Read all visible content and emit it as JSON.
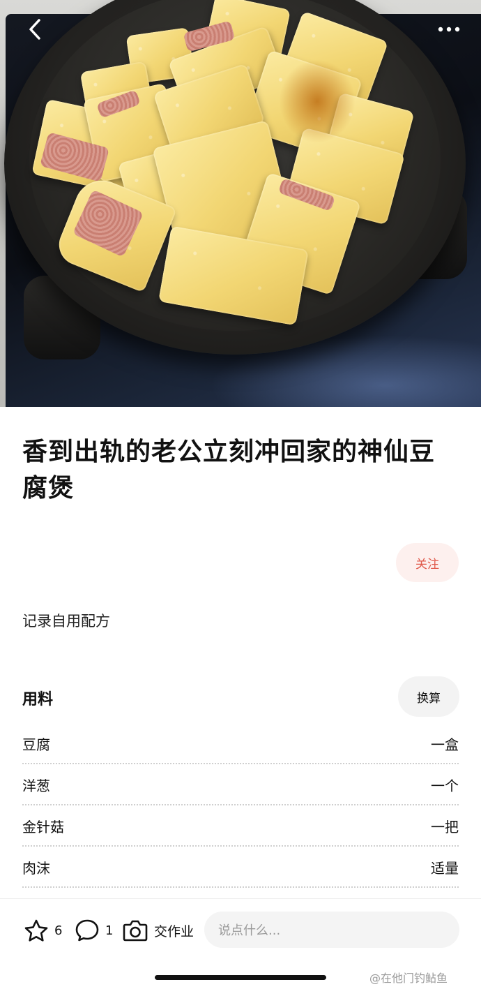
{
  "header": {
    "back_icon": "chevron-left-icon",
    "more_icon": "more-dots-icon"
  },
  "recipe": {
    "title": "香到出轨的老公立刻冲回家的神仙豆腐煲",
    "follow_label": "关注",
    "description": "记录自用配方"
  },
  "ingredients_section": {
    "heading": "用料",
    "convert_label": "换算",
    "items": [
      {
        "name": "豆腐",
        "amount": "一盒"
      },
      {
        "name": "洋葱",
        "amount": "一个"
      },
      {
        "name": "金针菇",
        "amount": "一把"
      },
      {
        "name": "肉沫",
        "amount": "适量"
      }
    ]
  },
  "bottom_bar": {
    "star_icon": "star-icon",
    "star_count": "6",
    "comment_icon": "comment-bubble-icon",
    "comment_count": "1",
    "camera_icon": "camera-icon",
    "homework_label": "交作业",
    "input_placeholder": "说点什么..."
  },
  "watermark": "@在他门钓鲇鱼",
  "colors": {
    "accent_red": "#e0594a",
    "follow_bg": "#fdf0ee",
    "pill_bg": "#f3f3f3"
  }
}
